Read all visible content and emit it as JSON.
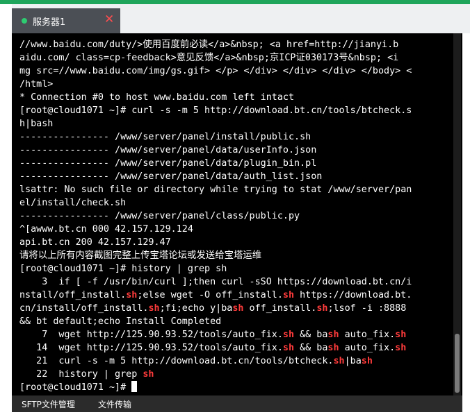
{
  "window": {
    "tab": {
      "label": "服务器1",
      "close_glyph": "✕",
      "status_color": "#2ecc71"
    },
    "accent": "#1fa55b"
  },
  "terminal": {
    "lines": [
      [
        {
          "t": "//www.baidu.com/duty/>使用百度前必读</a>&nbsp; <a href=http://jianyi.b"
        }
      ],
      [
        {
          "t": "aidu.com/ class=cp-feedback>意见反馈</a>&nbsp;京ICP证030173号&nbsp; <i"
        }
      ],
      [
        {
          "t": "mg src=//www.baidu.com/img/gs.gif> </p> </div> </div> </div> </body> <"
        }
      ],
      [
        {
          "t": "/html>"
        }
      ],
      [
        {
          "t": "* Connection #0 to host www.baidu.com left intact"
        }
      ],
      [
        {
          "t": "[root@cloud1071 ~]# curl -s -m 5 http://download.bt.cn/tools/btcheck.s"
        }
      ],
      [
        {
          "t": "h|bash"
        }
      ],
      [
        {
          "t": "---------------- /www/server/panel/install/public.sh"
        }
      ],
      [
        {
          "t": "---------------- /www/server/panel/data/userInfo.json"
        }
      ],
      [
        {
          "t": "---------------- /www/server/panel/data/plugin_bin.pl"
        }
      ],
      [
        {
          "t": "---------------- /www/server/panel/data/auth_list.json"
        }
      ],
      [
        {
          "t": "lsattr: No such file or directory while trying to stat /www/server/pan"
        }
      ],
      [
        {
          "t": "el/install/check.sh"
        }
      ],
      [
        {
          "t": "---------------- /www/server/panel/class/public.py"
        }
      ],
      [
        {
          "t": "^[awww.bt.cn 000 42.157.129.124"
        }
      ],
      [
        {
          "t": "api.bt.cn 200 42.157.129.47"
        }
      ],
      [
        {
          "t": "请将以上所有内容截图完整上传宝塔论坛或发送给宝塔运维"
        }
      ],
      [
        {
          "t": "[root@cloud1071 ~]# history | grep sh"
        }
      ],
      [
        {
          "t": "    3  if [ -f /usr/bin/curl ];then curl -sSO https://download.bt.cn/i"
        }
      ],
      [
        {
          "t": "nstall/off_install."
        },
        {
          "t": "sh",
          "hl": true
        },
        {
          "t": ";else wget -O off_install."
        },
        {
          "t": "sh",
          "hl": true
        },
        {
          "t": " https://download.bt."
        }
      ],
      [
        {
          "t": "cn/install/off_install."
        },
        {
          "t": "sh",
          "hl": true
        },
        {
          "t": ";fi;echo y|ba"
        },
        {
          "t": "sh",
          "hl": true
        },
        {
          "t": " off_install."
        },
        {
          "t": "sh",
          "hl": true
        },
        {
          "t": ";lsof -i :8888"
        }
      ],
      [
        {
          "t": "&& bt default;echo Install Completed"
        }
      ],
      [
        {
          "t": "    7  wget http://125.90.93.52/tools/auto_fix."
        },
        {
          "t": "sh",
          "hl": true
        },
        {
          "t": " && ba"
        },
        {
          "t": "sh",
          "hl": true
        },
        {
          "t": " auto_fix."
        },
        {
          "t": "sh",
          "hl": true
        }
      ],
      [
        {
          "t": "   14  wget http://125.90.93.52/tools/auto_fix."
        },
        {
          "t": "sh",
          "hl": true
        },
        {
          "t": " && ba"
        },
        {
          "t": "sh",
          "hl": true
        },
        {
          "t": " auto_fix."
        },
        {
          "t": "sh",
          "hl": true
        }
      ],
      [
        {
          "t": "   21  curl -s -m 5 http://download.bt.cn/tools/btcheck."
        },
        {
          "t": "sh",
          "hl": true
        },
        {
          "t": "|ba"
        },
        {
          "t": "sh",
          "hl": true
        }
      ],
      [
        {
          "t": "   22  history | grep "
        },
        {
          "t": "sh",
          "hl": true
        }
      ],
      [
        {
          "t": "[root@cloud1071 ~]# "
        }
      ]
    ],
    "highlight_color": "#ff3b3b"
  },
  "bottom_bar": {
    "sftp_label": "SFTP文件管理",
    "transfer_label": "文件传输"
  }
}
